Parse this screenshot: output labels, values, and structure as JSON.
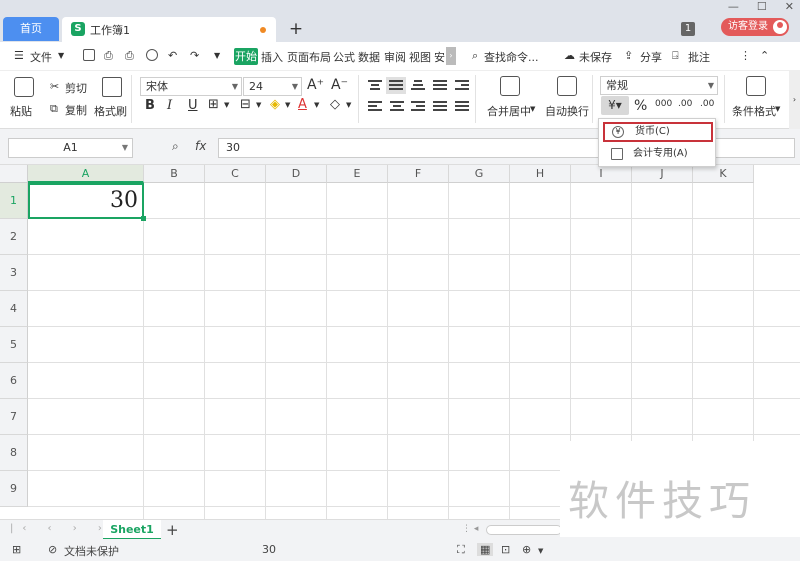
{
  "titlebar": {
    "home_tab": "首页",
    "doc_tab": "工作簿1",
    "doc_logo": "S",
    "new_tab": "+",
    "notify_count": "1",
    "visitor_login": "访客登录"
  },
  "menubar": {
    "file": "文件",
    "start": "开始",
    "insert": "插入",
    "page_layout": "页面布局",
    "formula": "公式",
    "data": "数据",
    "review": "审阅",
    "view": "视图",
    "more": "安",
    "search": "查找命令...",
    "unsaved": "未保存",
    "share": "分享",
    "comment": "批注"
  },
  "ribbon": {
    "paste": "粘贴",
    "cut": "剪切",
    "copy": "复制",
    "format_painter": "格式刷",
    "font_name": "宋体",
    "font_size": "24",
    "bold": "B",
    "italic": "I",
    "underline": "U",
    "merge_center": "合并居中",
    "wrap_text": "自动换行",
    "number_format": "常规",
    "percent": "%",
    "thousands": "000",
    "inc_decimal": ".00",
    "dec_decimal": ".00",
    "conditional_format": "条件格式"
  },
  "formulabar": {
    "name_box": "A1",
    "fx": "fx",
    "value": "30"
  },
  "grid": {
    "columns": [
      "A",
      "B",
      "C",
      "D",
      "E",
      "F",
      "G",
      "H",
      "I",
      "J",
      "K"
    ],
    "rows": [
      "1",
      "2",
      "3",
      "4",
      "5",
      "6",
      "7",
      "8",
      "9"
    ],
    "active_cell_value": "30"
  },
  "dropdown": {
    "currency": "货币(C)",
    "accounting": "会计专用(A)",
    "currency_symbol": "¥"
  },
  "sheetbar": {
    "sheet1": "Sheet1",
    "add": "+"
  },
  "statusbar": {
    "protect": "文档未保护",
    "sum": "30"
  },
  "watermark": "软件技巧",
  "colors": {
    "accent": "#1aa462",
    "home_tab": "#4d8ff0",
    "visitor": "#e35a5a",
    "highlight_box": "#c8323a"
  }
}
